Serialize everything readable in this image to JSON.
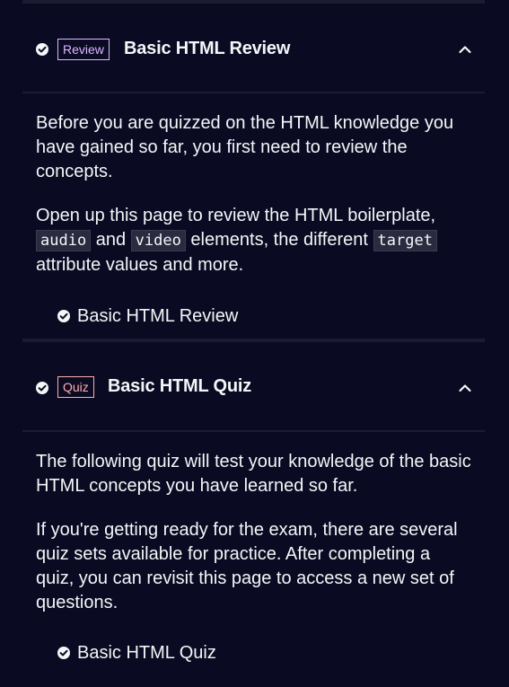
{
  "blocks": [
    {
      "badge": "Review",
      "title": "Basic HTML Review",
      "paragraph1": "Before you are quizzed on the HTML knowledge you have gained so far, you first need to review the concepts.",
      "p2_before": "Open up this page to review the HTML boilerplate, ",
      "code1": "audio",
      "p2_and": " and ",
      "code2": "video",
      "p2_mid": " elements, the different ",
      "code3": "target",
      "p2_after": " attribute values and more.",
      "link": "Basic HTML Review"
    },
    {
      "badge": "Quiz",
      "title": "Basic HTML Quiz",
      "paragraph1": "The following quiz will test your knowledge of the basic HTML concepts you have learned so far.",
      "paragraph2": "If you're getting ready for the exam, there are several quiz sets available for practice. After completing a quiz, you can revisit this page to access a new set of questions.",
      "link": "Basic HTML Quiz"
    }
  ],
  "colors": {
    "background": "#0a0a23",
    "divider": "#1b1b32",
    "review_badge": "#dbb8ff",
    "quiz_badge": "#ffadad",
    "text": "#f5f6f7"
  },
  "icons": {
    "completed": "check-circle-icon",
    "collapse": "chevron-up-icon"
  }
}
